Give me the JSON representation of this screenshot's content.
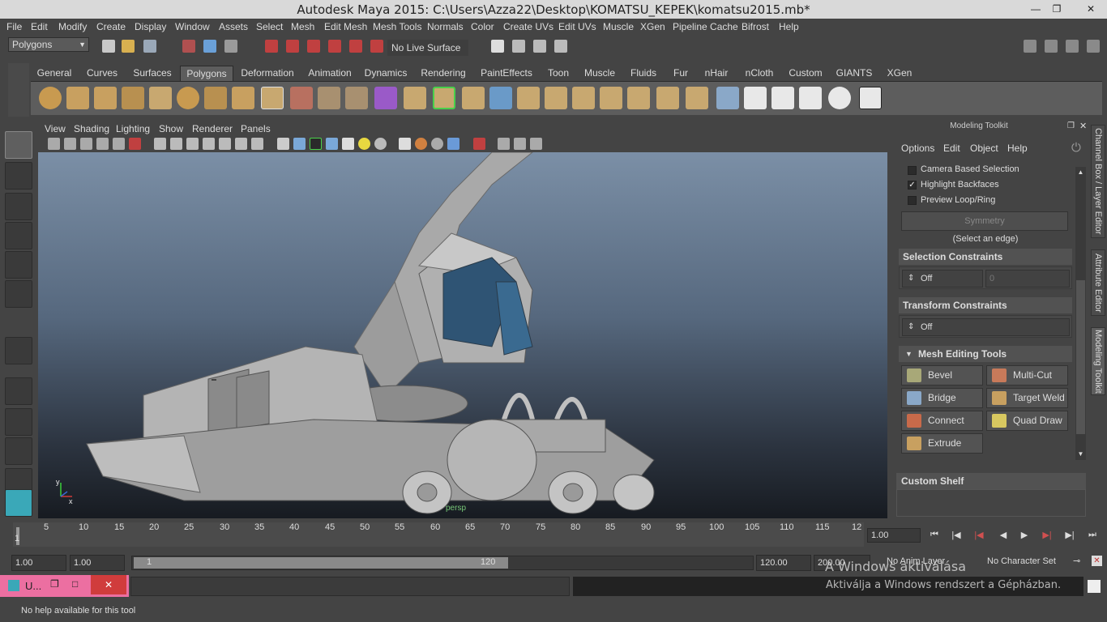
{
  "window": {
    "title": "Autodesk Maya 2015: C:\\Users\\Azza22\\Desktop\\KOMATSU_KEPEK\\komatsu2015.mb*",
    "minimize": "—",
    "maximize": "❐",
    "close": "✕"
  },
  "menus": [
    "File",
    "Edit",
    "Modify",
    "Create",
    "Display",
    "Window",
    "Assets",
    "Select",
    "Mesh",
    "Edit Mesh",
    "Mesh Tools",
    "Normals",
    "Color",
    "Create UVs",
    "Edit UVs",
    "Muscle",
    "XGen",
    "Pipeline Cache",
    "Bifrost",
    "Help"
  ],
  "statusline": {
    "menuset": "Polygons",
    "live_surface": "No Live Surface"
  },
  "shelf_tabs": [
    "General",
    "Curves",
    "Surfaces",
    "Polygons",
    "Deformation",
    "Animation",
    "Dynamics",
    "Rendering",
    "PaintEffects",
    "Toon",
    "Muscle",
    "Fluids",
    "Fur",
    "nHair",
    "nCloth",
    "Custom",
    "GIANTS",
    "XGen"
  ],
  "active_shelf_tab": "Polygons",
  "panel_menus": [
    "View",
    "Shading",
    "Lighting",
    "Show",
    "Renderer",
    "Panels"
  ],
  "viewport": {
    "camera_label": "persp",
    "axis_y": "y",
    "axis_x": "x"
  },
  "modeling_toolkit": {
    "title": "Modeling Toolkit",
    "menus": [
      "Options",
      "Edit",
      "Object",
      "Help"
    ],
    "options": [
      {
        "label": "Camera Based Selection",
        "checked": false
      },
      {
        "label": "Highlight Backfaces",
        "checked": true
      },
      {
        "label": "Preview Loop/Ring",
        "checked": false
      }
    ],
    "symmetry_label": "Symmetry",
    "symmetry_hint": "(Select an edge)",
    "selection_constraints": {
      "header": "Selection Constraints",
      "value": "Off",
      "number": "0"
    },
    "transform_constraints": {
      "header": "Transform Constraints",
      "value": "Off"
    },
    "mesh_editing_tools": {
      "header": "Mesh Editing Tools",
      "tools": [
        "Bevel",
        "Multi-Cut",
        "Bridge",
        "Target Weld",
        "Connect",
        "Quad Draw",
        "Extrude"
      ]
    },
    "custom_shelf": "Custom Shelf"
  },
  "side_tabs": [
    "Channel Box / Layer Editor",
    "Attribute Editor",
    "Modeling Toolkit"
  ],
  "time_slider": {
    "ticks": [
      "1",
      "5",
      "10",
      "15",
      "20",
      "25",
      "30",
      "35",
      "40",
      "45",
      "50",
      "55",
      "60",
      "65",
      "70",
      "75",
      "80",
      "85",
      "90",
      "95",
      "100",
      "105",
      "110",
      "115",
      "12"
    ],
    "current_frame": "1.00"
  },
  "range_slider": {
    "start": "1.00",
    "playback_start": "1.00",
    "range_low": "1",
    "range_high": "120",
    "playback_end": "120.00",
    "end": "200.00",
    "anim_layer": "No Anim Layer",
    "character_set": "No Character Set"
  },
  "taskbar_item": "U...",
  "help_line": "No help available for this tool",
  "activation_watermark": {
    "line1": "A Windows aktiválása",
    "line2": "Aktiválja a Windows rendszert a Gépházban."
  }
}
